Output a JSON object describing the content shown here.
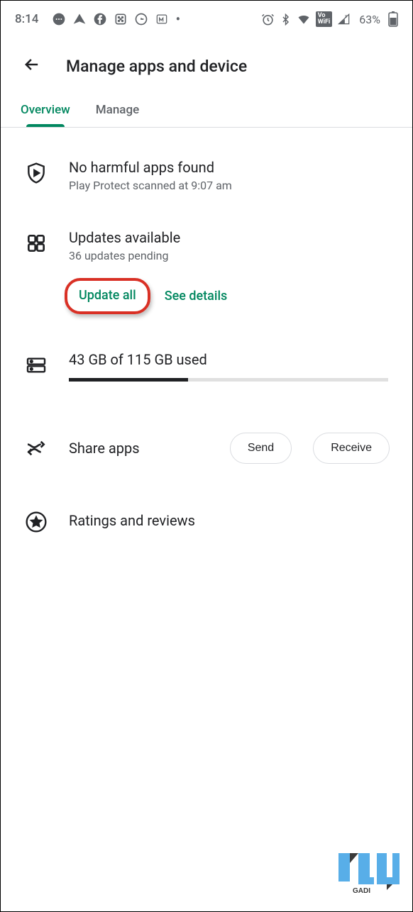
{
  "status": {
    "time": "8:14",
    "battery_pct": "63%"
  },
  "header": {
    "title": "Manage apps and device"
  },
  "tabs": {
    "overview": "Overview",
    "manage": "Manage"
  },
  "protect": {
    "title": "No harmful apps found",
    "sub": "Play Protect scanned at 9:07 am"
  },
  "updates": {
    "title": "Updates available",
    "sub": "36 updates pending",
    "update_all": "Update all",
    "see_details": "See details"
  },
  "storage": {
    "label": "43 GB of 115 GB used",
    "used": 43,
    "total": 115
  },
  "share": {
    "title": "Share apps",
    "send": "Send",
    "receive": "Receive"
  },
  "reviews": {
    "title": "Ratings and reviews"
  }
}
